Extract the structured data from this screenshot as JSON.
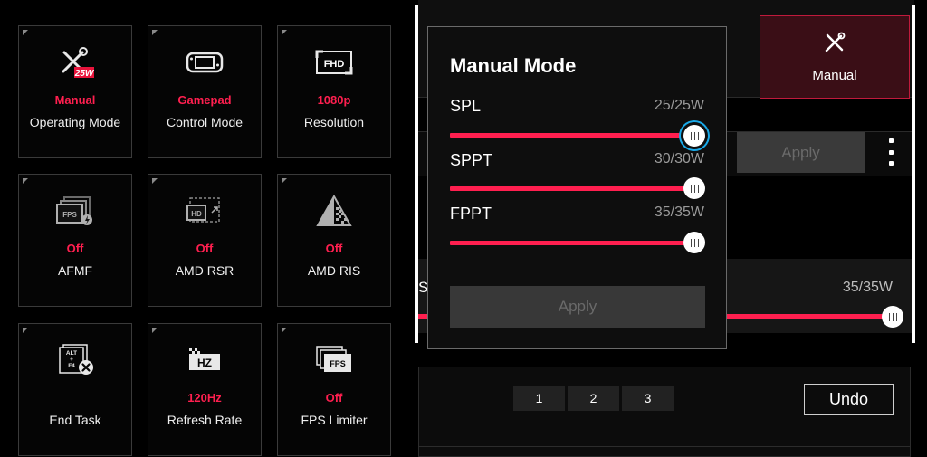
{
  "tiles": [
    {
      "id": "operating-mode",
      "status": "Manual",
      "label": "Operating Mode",
      "icon": "wrench-screwdriver-icon",
      "badge": "25W"
    },
    {
      "id": "control-mode",
      "status": "Gamepad",
      "label": "Control Mode",
      "icon": "handheld-console-icon"
    },
    {
      "id": "resolution",
      "status": "1080p",
      "label": "Resolution",
      "icon": "fhd-icon",
      "badge": "FHD"
    },
    {
      "id": "afmf",
      "status": "Off",
      "label": "AFMF",
      "icon": "fps-frames-icon",
      "badge": "FPS"
    },
    {
      "id": "amd-rsr",
      "status": "Off",
      "label": "AMD RSR",
      "icon": "hd-upscale-icon",
      "badge": "HD"
    },
    {
      "id": "amd-ris",
      "status": "Off",
      "label": "AMD RIS",
      "icon": "sharpen-triangle-icon"
    },
    {
      "id": "end-task",
      "status": "",
      "label": "End Task",
      "icon": "alt-f4-close-icon",
      "badge_top": "ALT",
      "badge_mid": "+",
      "badge_bot": "F4"
    },
    {
      "id": "refresh-rate",
      "status": "120Hz",
      "label": "Refresh Rate",
      "icon": "hz-checker-icon",
      "badge": "HZ"
    },
    {
      "id": "fps-limiter",
      "status": "Off",
      "label": "FPS Limiter",
      "icon": "fps-limiter-icon",
      "badge": "FPS"
    }
  ],
  "background": {
    "manual_button_label": "Manual",
    "apply_label": "Apply",
    "partial_letter": "S",
    "fppt_value": "35/35W",
    "fppt_level": 1.0,
    "pages": [
      "1",
      "2",
      "3"
    ],
    "undo_label": "Undo"
  },
  "modal": {
    "title": "Manual Mode",
    "sliders": [
      {
        "name": "SPL",
        "value": "25/25W",
        "level": 1.0,
        "focused": true
      },
      {
        "name": "SPPT",
        "value": "30/30W",
        "level": 1.0,
        "focused": false
      },
      {
        "name": "FPPT",
        "value": "35/35W",
        "level": 1.0,
        "focused": false
      }
    ],
    "apply_label": "Apply"
  },
  "colors": {
    "accent": "#ff1f4f",
    "focus_ring": "#19a9e8",
    "tile_border": "#3a3a3a",
    "manual_button_bg": "#3a0e16"
  }
}
